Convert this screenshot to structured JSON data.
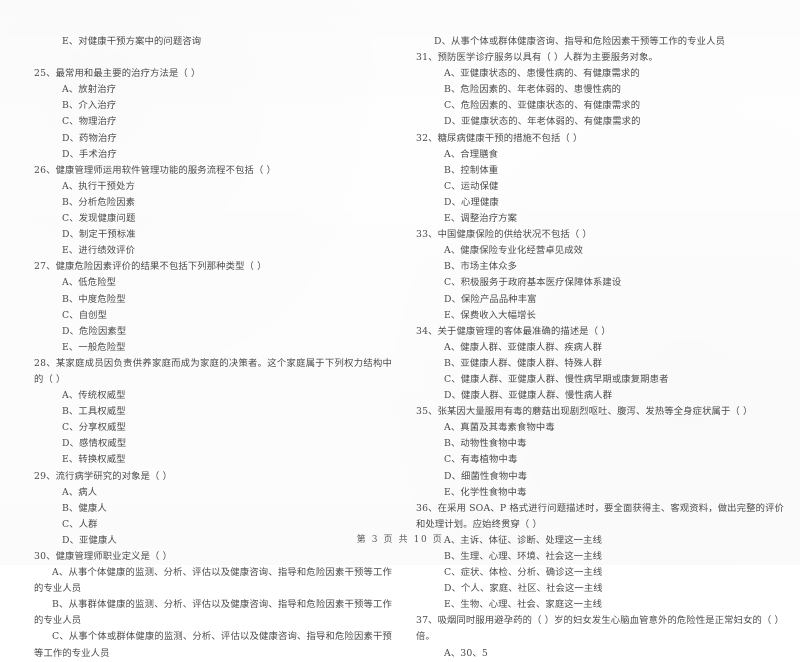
{
  "document": {
    "type": "scanned-exam-paper",
    "footer": "第 3 页 共 10 页"
  },
  "left_column": {
    "lead_option": "E、对健康干预方案中的问题咨询",
    "questions": [
      {
        "stem": "25、最常用和最主要的治疗方法是（     ）",
        "options": [
          "A、放射治疗",
          "B、介入治疗",
          "C、物理治疗",
          "D、药物治疗",
          "D、手术治疗"
        ]
      },
      {
        "stem": "26、健康管理师运用软件管理功能的服务流程不包括（     ）",
        "options": [
          "A、执行干预处方",
          "B、分析危险因素",
          "C、发现健康问题",
          "D、制定干预标准",
          "E、进行绩效评价"
        ]
      },
      {
        "stem": "27、健康危险因素评价的结果不包括下列那种类型（     ）",
        "options": [
          "A、低危险型",
          "B、中度危险型",
          "C、自创型",
          "D、危险因素型",
          "E、一般危险型"
        ]
      },
      {
        "stem": "28、某家庭成员因负责供养家庭而成为家庭的决策者。这个家庭属于下列权力结构中的（     ）",
        "options": [
          "A、传统权威型",
          "B、工具权威型",
          "C、分享权威型",
          "D、感情权威型",
          "E、转换权威型"
        ]
      },
      {
        "stem": "29、流行病学研究的对象是（     ）",
        "options": [
          "A、病人",
          "B、健康人",
          "C、人群",
          "D、亚健康人"
        ]
      },
      {
        "stem": "30、健康管理师职业定义是（     ）",
        "continuations": [
          "A、从事个体健康的监测、分析、评估以及健康咨询、指导和危险因素干预等工作的专业人员",
          "B、从事群体健康的监测、分析、评估以及健康咨询、指导和危险因素干预等工作的专业人员",
          "C、从事个体或群体健康的监测、分析、评估以及健康咨询、指导和危险因素干预等工作的专业人员"
        ]
      }
    ]
  },
  "right_column": {
    "lead_option": "D、从事个体或群体健康咨询、指导和危险因素干预等工作的专业人员",
    "questions": [
      {
        "stem": "31、预防医学诊疗服务以具有（     ）人群为主要服务对象。",
        "options": [
          "A、亚健康状态的、患慢性病的、有健康需求的",
          "B、危险因素的、年老体弱的、患慢性病的",
          "C、危险因素的、亚健康状态的、有健康需求的",
          "D、亚健康状态的、年老体弱的、有健康需求的"
        ]
      },
      {
        "stem": "32、糖尿病健康干预的措施不包括（     ）",
        "options": [
          "A、合理膳食",
          "B、控制体重",
          "C、运动保健",
          "D、心理健康",
          "E、调整治疗方案"
        ]
      },
      {
        "stem": "33、中国健康保险的供给状况不包括（     ）",
        "options": [
          "A、健康保险专业化经营卓见成效",
          "B、市场主体众多",
          "C、积极服务于政府基本医疗保障体系建设",
          "D、保险产品品种丰富",
          "E、保费收入大幅增长"
        ]
      },
      {
        "stem": "34、关于健康管理的客体最准确的描述是（     ）",
        "options": [
          "A、健康人群、亚健康人群、疾病人群",
          "B、亚健康人群、健康人群、特殊人群",
          "C、健康人群、亚健康人群、慢性病早期或康复期患者",
          "D、健康人群、亚健康人群、慢性病人群"
        ]
      },
      {
        "stem": "35、张某因大量服用有毒的蘑菇出现剧烈呕吐、腹泻、发热等全身症状属于（     ）",
        "options": [
          "A、真菌及其毒素食物中毒",
          "B、动物性食物中毒",
          "C、有毒植物中毒",
          "D、细菌性食物中毒",
          "E、化学性食物中毒"
        ]
      },
      {
        "stem": "36、在采用 SOA、P 格式进行问题描述时，要全面获得主、客观资料，做出完整的评价和处理计划。应始终贯穿（     ）",
        "options": [
          "A、主诉、体征、诊断、处理这一主线",
          "B、生理、心理、环境、社会这一主线",
          "C、症状、体检、分析、确诊这一主线",
          "D、个人、家庭、社区、社会这一主线",
          "E、生物、心理、社会、家庭这一主线"
        ]
      },
      {
        "stem": "37、吸烟同时服用避孕药的（          ）岁的妇女发生心脑血管意外的危险性是正常妇女的（     ）倍。",
        "options": [
          "A、30、5"
        ]
      }
    ]
  }
}
